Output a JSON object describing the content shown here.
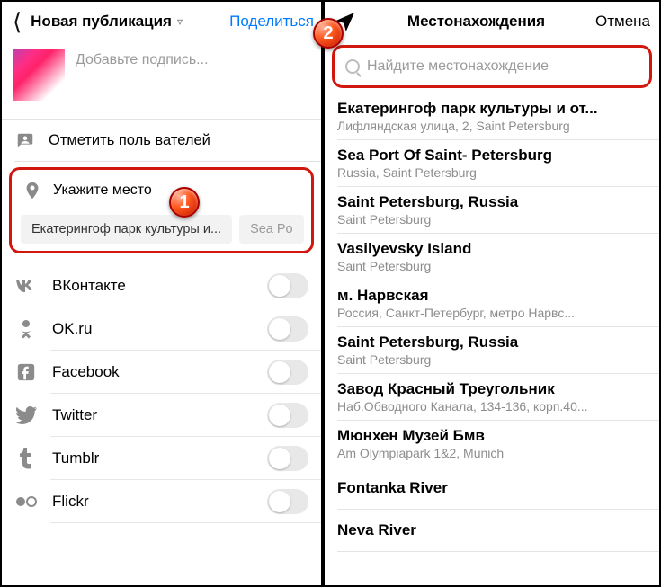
{
  "left": {
    "title": "Новая публикация",
    "share": "Поделиться",
    "caption_placeholder": "Добавьте подпись...",
    "tag_people": "Отметить поль    вателей",
    "add_location": "Укажите место",
    "chips": [
      "Екатерингоф парк культуры и...",
      "Sea Po"
    ],
    "social": [
      {
        "name": "ВКонтакте"
      },
      {
        "name": "OK.ru"
      },
      {
        "name": "Facebook"
      },
      {
        "name": "Twitter"
      },
      {
        "name": "Tumblr"
      },
      {
        "name": "Flickr"
      }
    ]
  },
  "right": {
    "title": "Местонахождения",
    "cancel": "Отмена",
    "search_placeholder": "Найдите местонахождение",
    "results": [
      {
        "title": "Екатерингоф парк культуры и от...",
        "sub": "Лифляндская улица, 2, Saint Petersburg"
      },
      {
        "title": "Sea Port Of Saint- Petersburg",
        "sub": "Russia, Saint Petersburg"
      },
      {
        "title": "Saint Petersburg, Russia",
        "sub": "Saint Petersburg"
      },
      {
        "title": "Vasilyevsky Island",
        "sub": "Saint Petersburg"
      },
      {
        "title": "м. Нарвская",
        "sub": "Россия, Санкт-Петербург, метро Нарвс..."
      },
      {
        "title": "Saint Petersburg, Russia",
        "sub": "Saint Petersburg"
      },
      {
        "title": "Завод Красный Треугольник",
        "sub": "Наб.Обводного Канала, 134-136, корп.40..."
      },
      {
        "title": "Мюнхен Музей Бмв",
        "sub": "Am Olympiapark 1&2, Munich"
      },
      {
        "title": "Fontanka River",
        "sub": ""
      },
      {
        "title": "Neva River",
        "sub": ""
      }
    ]
  },
  "badges": {
    "one": "1",
    "two": "2"
  }
}
